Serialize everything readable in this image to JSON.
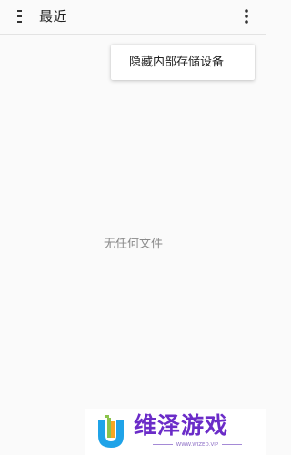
{
  "toolbar": {
    "title": "最近",
    "menu_icon": "hamburger-icon",
    "overflow_icon": "more-vert-icon"
  },
  "popup_menu": {
    "items": [
      {
        "label": "隐藏内部存储设备"
      }
    ]
  },
  "empty_state": {
    "message": "无任何文件"
  },
  "banner": {
    "brand": "维泽游戏",
    "subtitle": "WWW.WIZED.VIP",
    "brand_color": "#6b2cc8",
    "logo_colors": [
      "#1fa3e8",
      "#8bc34a",
      "#f5a623"
    ]
  }
}
